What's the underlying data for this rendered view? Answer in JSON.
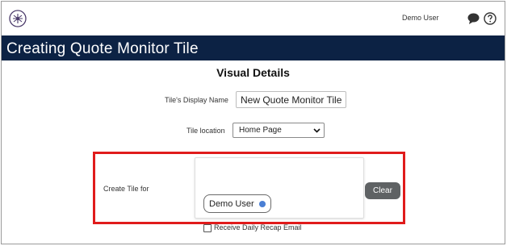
{
  "header": {
    "user_name": "Demo User"
  },
  "page": {
    "title": "Creating Quote Monitor Tile"
  },
  "form": {
    "section_title": "Visual Details",
    "display_name_label": "Tile's Display Name",
    "display_name_value": "New Quote Monitor Tile",
    "location_label": "Tile location",
    "location_value": "Home Page",
    "create_for_label": "Create Tile for",
    "selected_users": [
      {
        "label": "Demo User"
      }
    ],
    "clear_label": "Clear",
    "recap_label": "Receive Daily Recap Email",
    "recap_checked": false
  },
  "colors": {
    "title_bar": "#0c2244",
    "highlight": "#e01b1b",
    "clear_button": "#5f6264",
    "chip_remove": "#4a7fd4"
  },
  "icons": [
    "app-logo-icon",
    "chat-bubble-icon",
    "help-icon",
    "chevron-down-icon",
    "remove-chip-icon"
  ]
}
